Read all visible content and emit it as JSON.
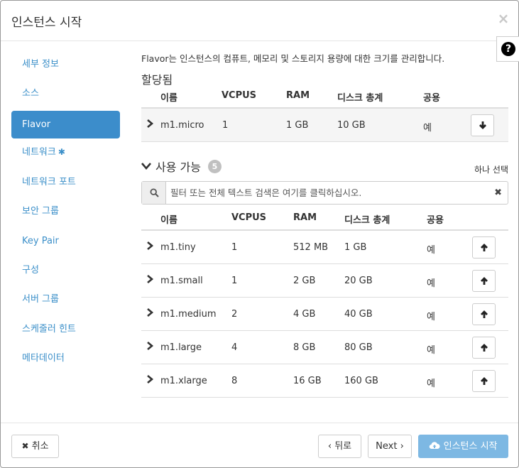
{
  "modal": {
    "title": "인스턴스 시작",
    "close_symbol": "×",
    "help_symbol": "?"
  },
  "sidebar": {
    "items": [
      {
        "label": "세부 정보",
        "active": false,
        "required": false
      },
      {
        "label": "소스",
        "active": false,
        "required": false
      },
      {
        "label": "Flavor",
        "active": true,
        "required": false
      },
      {
        "label": "네트워크",
        "active": false,
        "required": true
      },
      {
        "label": "네트워크 포트",
        "active": false,
        "required": false
      },
      {
        "label": "보안 그룹",
        "active": false,
        "required": false
      },
      {
        "label": "Key Pair",
        "active": false,
        "required": false
      },
      {
        "label": "구성",
        "active": false,
        "required": false
      },
      {
        "label": "서버 그룹",
        "active": false,
        "required": false
      },
      {
        "label": "스케줄러 힌트",
        "active": false,
        "required": false
      },
      {
        "label": "메타데이터",
        "active": false,
        "required": false
      }
    ],
    "required_mark": "✱"
  },
  "content": {
    "description": "Flavor는 인스턴스의 컴퓨트, 메모리 및 스토리지 용량에 대한 크기를 관리합니다.",
    "allocated_title": "할당됨",
    "columns": [
      "이름",
      "VCPUS",
      "RAM",
      "디스크 총계",
      "공용"
    ],
    "allocated_rows": [
      {
        "name": "m1.micro",
        "vcpus": "1",
        "ram": "1 GB",
        "disk": "10 GB",
        "public": "예"
      }
    ],
    "available_title": "사용 가능",
    "available_count": "5",
    "pick_one": "하나 선택",
    "search_placeholder": "필터 또는 전체 텍스트 검색은 여기를 클릭하십시오.",
    "available_rows": [
      {
        "name": "m1.tiny",
        "vcpus": "1",
        "ram": "512 MB",
        "disk": "1 GB",
        "public": "예"
      },
      {
        "name": "m1.small",
        "vcpus": "1",
        "ram": "2 GB",
        "disk": "20 GB",
        "public": "예"
      },
      {
        "name": "m1.medium",
        "vcpus": "2",
        "ram": "4 GB",
        "disk": "40 GB",
        "public": "예"
      },
      {
        "name": "m1.large",
        "vcpus": "4",
        "ram": "8 GB",
        "disk": "80 GB",
        "public": "예"
      },
      {
        "name": "m1.xlarge",
        "vcpus": "8",
        "ram": "16 GB",
        "disk": "160 GB",
        "public": "예"
      }
    ]
  },
  "footer": {
    "cancel_label": "취소",
    "back_label": "뒤로",
    "next_label": "Next",
    "launch_label": "인스턴스 시작"
  },
  "colors": {
    "accent": "#3c8dcb",
    "link": "#3b8fc9",
    "primary_disabled": "#7db8e3",
    "badge": "#c0c0c0"
  },
  "icons": {
    "close": "close-icon",
    "help": "question-circle-icon",
    "required": "asterisk-icon",
    "expand_row": "chevron-right-icon",
    "collapse_section": "chevron-down-icon",
    "deallocate": "arrow-down-icon",
    "allocate": "arrow-up-icon",
    "search": "search-icon",
    "clear": "times-icon",
    "cancel": "times-icon",
    "back": "chevron-left-icon",
    "next": "chevron-right-icon",
    "launch": "cloud-upload-icon"
  }
}
